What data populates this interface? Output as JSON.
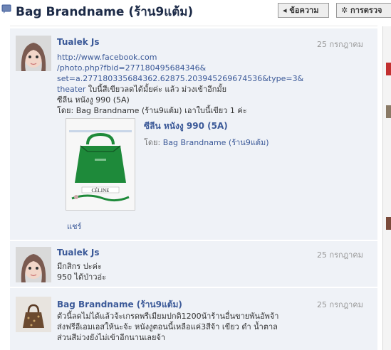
{
  "header": {
    "title": "Bag Brandname (ร้าน9แต้ม)",
    "message_button": "◂ ข้อความ",
    "settings_button": "✲ การตรวจ",
    "icon": "chat-bubble-icon"
  },
  "posts": [
    {
      "author": "Tualek Js",
      "date": "25 กรกฎาคม",
      "link_line1": "http://www.facebook.com",
      "link_line2": "/photo.php?fbid=277180495684346&",
      "link_line3": "set=a.277180335684362.62875.203945269674536&type=3&",
      "link_line4": "theater",
      "text_after_link": " ใบนี้สีเขียวลดได้มั้ยค่ะ แล้ว ม่วงเข้าอีกมั้ย",
      "text_line2": "ซีลีน หนังงู 990 (5A)",
      "text_line3": "โดย: Bag Brandname (ร้าน9แต้ม) เอาใบนี้เขียว 1 ค่ะ",
      "attachment_title": "ซีลีน หนังงู 990 (5A)",
      "attachment_by_label": "โดย:",
      "attachment_by": "Bag Brandname (ร้าน9แต้ม)",
      "share": "แชร์",
      "thumb_brand": "CÉLINE"
    },
    {
      "author": "Tualek Js",
      "date": "25 กรกฎาคม",
      "text_line1": "มีกสิกร ปะค่ะ",
      "text_line2": "950 ได้ป่าวอ่ะ"
    },
    {
      "author": "Bag Brandname (ร้าน9แต้ม)",
      "date": "25 กรกฎาคม",
      "text_line1": "ตัวนี้ลดไม่ได้แล้วจ้ะเกรดพรีเมียมปกติ1200น้าร้านอื่นขายพันอัพจ้า",
      "text_line2": "ส่งฟรีอีเอมเอสให้นะจ้ะ หนังงูตอนนี้เหลือแค่3สีจ้า เขียว ดำ น้ำตาล",
      "text_line3": "ส่วนสีม่วงยังไม่เข้าอีกนานเลยจ้า"
    }
  ],
  "colors": {
    "link": "#3b5998",
    "panel": "#eff2f7",
    "bag": "#1e8a3a"
  }
}
